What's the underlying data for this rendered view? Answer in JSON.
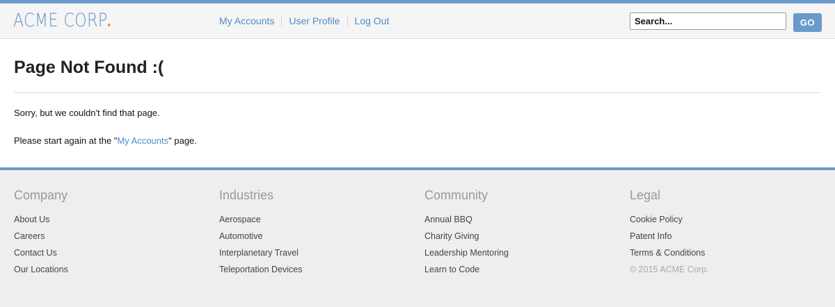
{
  "header": {
    "logo_text": "ACME CORP",
    "nav": [
      {
        "label": "My Accounts"
      },
      {
        "label": "User Profile"
      },
      {
        "label": "Log Out"
      }
    ],
    "search": {
      "placeholder": "Search..."
    },
    "go_label": "GO"
  },
  "main": {
    "title": "Page Not Found :(",
    "message1": "Sorry, but we couldn't find that page.",
    "message2_prefix": "Please start again at the \"",
    "message2_link": "My Accounts",
    "message2_suffix": "\" page."
  },
  "footer": {
    "columns": [
      {
        "heading": "Company",
        "links": [
          "About Us",
          "Careers",
          "Contact Us",
          "Our Locations"
        ]
      },
      {
        "heading": "Industries",
        "links": [
          "Aerospace",
          "Automotive",
          "Interplanetary Travel",
          "Teleportation Devices"
        ]
      },
      {
        "heading": "Community",
        "links": [
          "Annual BBQ",
          "Charity Giving",
          "Leadership Mentoring",
          "Learn to Code"
        ]
      },
      {
        "heading": "Legal",
        "links": [
          "Cookie Policy",
          "Patent Info",
          "Terms & Conditions"
        ]
      }
    ],
    "copyright": "© 2015 ACME Corp."
  },
  "colors": {
    "accent": "#6a9acb",
    "link": "#4f8bc6",
    "logo_dot": "#e08a3c"
  }
}
